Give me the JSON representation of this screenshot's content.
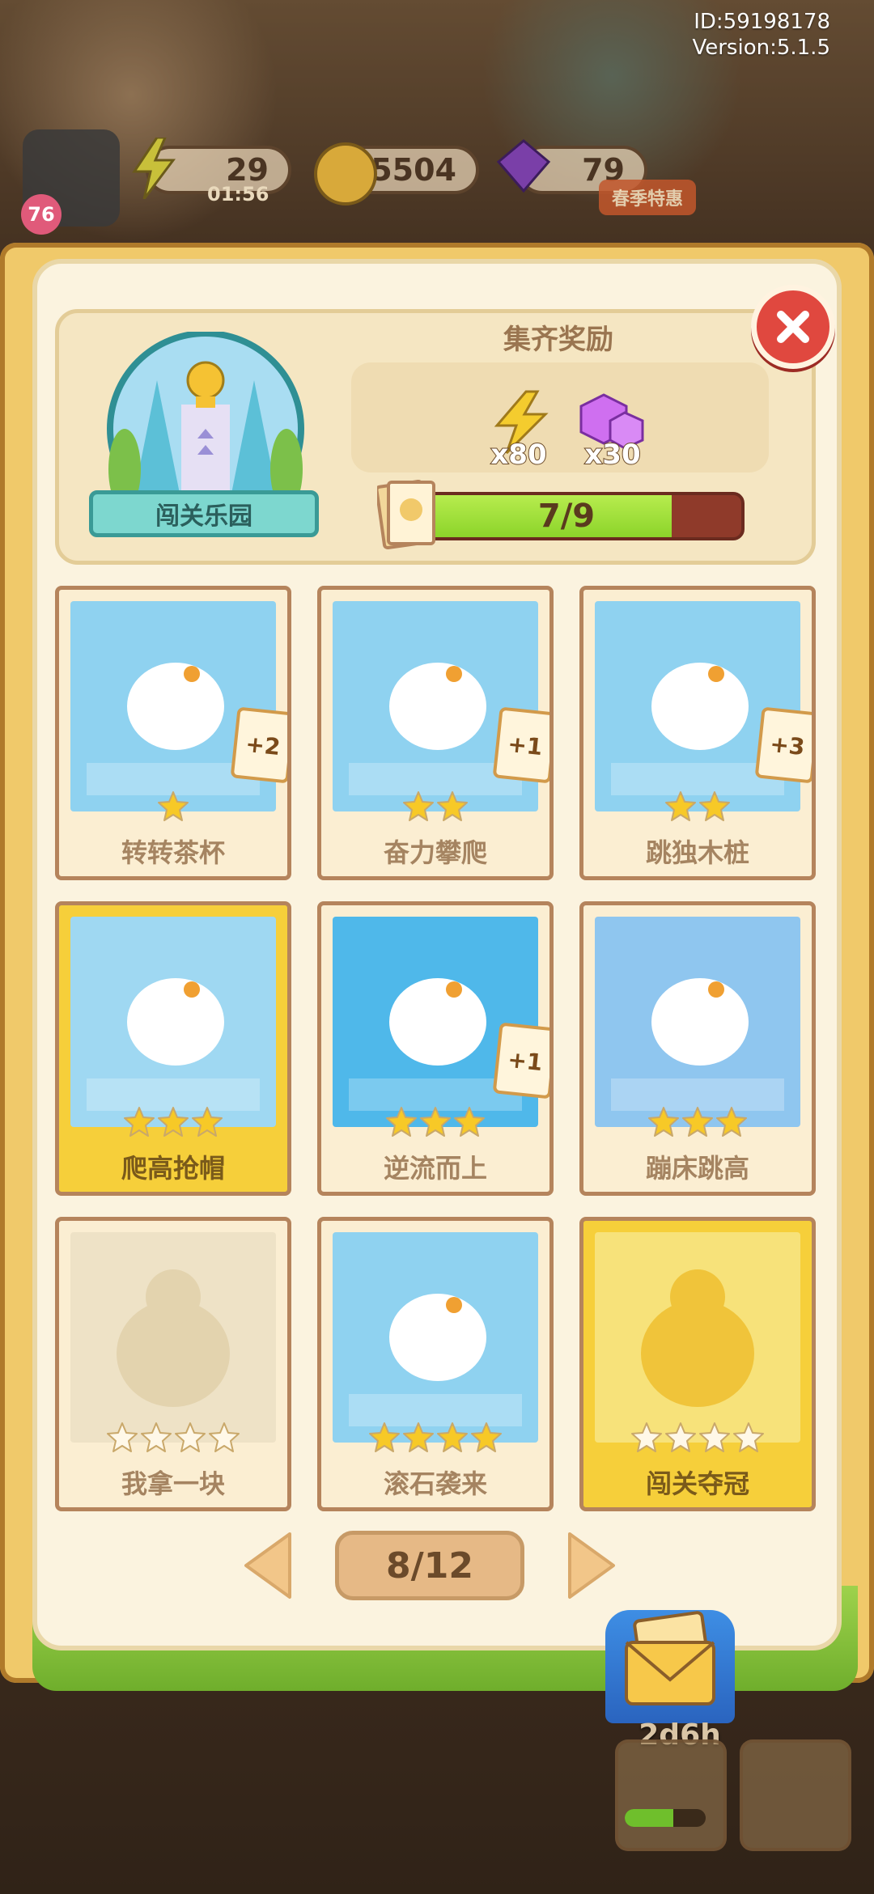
{
  "status": {
    "id_text": "ID:59198178",
    "version_text": "Version:5.1.5"
  },
  "hud": {
    "level": "76",
    "energy": "29",
    "energy_timer": "01:56",
    "coins": "95504",
    "gems": "79",
    "event_badge": "春季特惠"
  },
  "album": {
    "badge_label": "闯关乐园",
    "reward_title": "集齐奖励",
    "rewards": [
      {
        "icon": "lightning-icon",
        "amount": "x80"
      },
      {
        "icon": "gem-icon",
        "amount": "x30"
      }
    ],
    "progress_text": "7/9",
    "progress_fraction": 0.78
  },
  "cards": [
    {
      "label": "转转茶杯",
      "stars": 1,
      "max_stars": 1,
      "bonus": "+2",
      "owned": true,
      "gold": false,
      "art": "#8fd2f0"
    },
    {
      "label": "奋力攀爬",
      "stars": 2,
      "max_stars": 2,
      "bonus": "+1",
      "owned": true,
      "gold": false,
      "art": "#8fd2f0"
    },
    {
      "label": "跳独木桩",
      "stars": 2,
      "max_stars": 2,
      "bonus": "+3",
      "owned": true,
      "gold": false,
      "art": "#8fd2f0"
    },
    {
      "label": "爬高抢帽",
      "stars": 3,
      "max_stars": 3,
      "bonus": "",
      "owned": true,
      "gold": true,
      "art": "#9fd8f2"
    },
    {
      "label": "逆流而上",
      "stars": 3,
      "max_stars": 3,
      "bonus": "+1",
      "owned": true,
      "gold": false,
      "art": "#4fb8ea"
    },
    {
      "label": "蹦床跳高",
      "stars": 3,
      "max_stars": 3,
      "bonus": "",
      "owned": true,
      "gold": false,
      "art": "#8fc6ef"
    },
    {
      "label": "我拿一块",
      "stars": 0,
      "max_stars": 4,
      "bonus": "",
      "owned": false,
      "gold": false,
      "art": "#eee2c6"
    },
    {
      "label": "滚石袭来",
      "stars": 4,
      "max_stars": 4,
      "bonus": "",
      "owned": true,
      "gold": false,
      "art": "#8fd2f0"
    },
    {
      "label": "闯关夺冠",
      "stars": 0,
      "max_stars": 4,
      "bonus": "",
      "owned": false,
      "gold": true,
      "art": "#f7e27a"
    }
  ],
  "pagination": {
    "page_text": "8/12"
  },
  "dock": {
    "timer": "2d6h"
  },
  "colors": {
    "star_filled": "#f7c927",
    "star_empty": "#fff8e8",
    "accent_green": "#8cd42a",
    "close_red": "#e0483f"
  }
}
